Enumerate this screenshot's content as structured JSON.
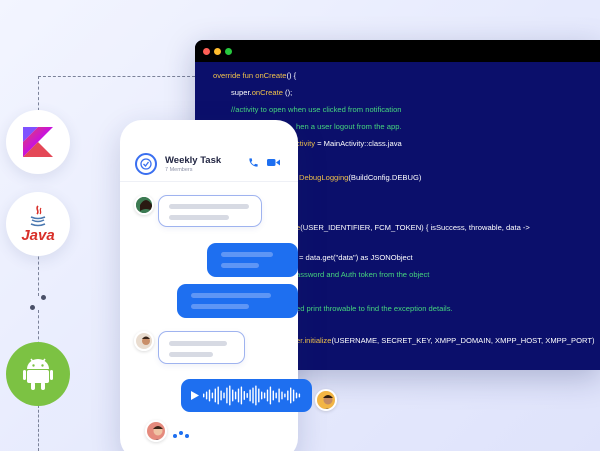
{
  "colors": {
    "code_bg": "#0b0f6b",
    "keyword": "#f0c24a",
    "comment": "#46d57e",
    "bubble_out": "#1e6ff0",
    "android_green": "#7cc243",
    "kotlin_purple": "#7f52ff",
    "java_red": "#d8302a"
  },
  "tech_icons": [
    {
      "name": "kotlin-icon"
    },
    {
      "name": "java-icon",
      "label": "Java"
    },
    {
      "name": "android-icon"
    }
  ],
  "code": {
    "window_dots": [
      "#ff5f56",
      "#ffbd2e",
      "#27c93f"
    ],
    "lines": [
      [
        {
          "t": "override fun ",
          "c": "kw"
        },
        {
          "t": "onCreate",
          "c": "kw"
        },
        {
          "t": "() {",
          "c": "plain"
        }
      ],
      [
        {
          "t": "super.",
          "c": "plain"
        },
        {
          "t": "onCreate",
          "c": "kw"
        },
        {
          "t": " ();",
          "c": "plain"
        }
      ],
      [
        {
          "t": "//activity to open when use clicked from notification",
          "c": "comment"
        }
      ],
      [
        {
          "t": "hen a user logout from the app.",
          "c": "comment"
        }
      ],
      [
        {
          "t": "ctivity",
          "c": "kw"
        },
        {
          "t": " = MainActivity::class.java",
          "c": "plain"
        }
      ],
      [
        {
          "t": "DebugLogging",
          "c": "kw"
        },
        {
          "t": "(BuildConfig.DEBUG)",
          "c": "plain"
        }
      ],
      [
        {
          "t": "e",
          "c": "kw"
        },
        {
          "t": "(USER_IDENTIFIER, FCM_TOKEN) { isSuccess, throwable, data ->",
          "c": "plain"
        }
      ],
      [
        {
          "t": "= data.get(\"data\") as JSONObject",
          "c": "plain"
        }
      ],
      [
        {
          "t": "assword and Auth token from the object",
          "c": "comment"
        }
      ],
      [
        {
          "t": "ed print throwable to find the exception details.",
          "c": "comment"
        }
      ],
      [
        {
          "t": "er.initialize",
          "c": "kw"
        },
        {
          "t": "(USERNAME, SECRET_KEY, XMPP_DOMAIN, XMPP_HOST, XMPP_PORT)",
          "c": "plain"
        }
      ]
    ]
  },
  "chat": {
    "title": "Weekly Task",
    "subtitle": "7 Members",
    "header_icons": [
      "phone-icon",
      "video-call-icon"
    ]
  }
}
